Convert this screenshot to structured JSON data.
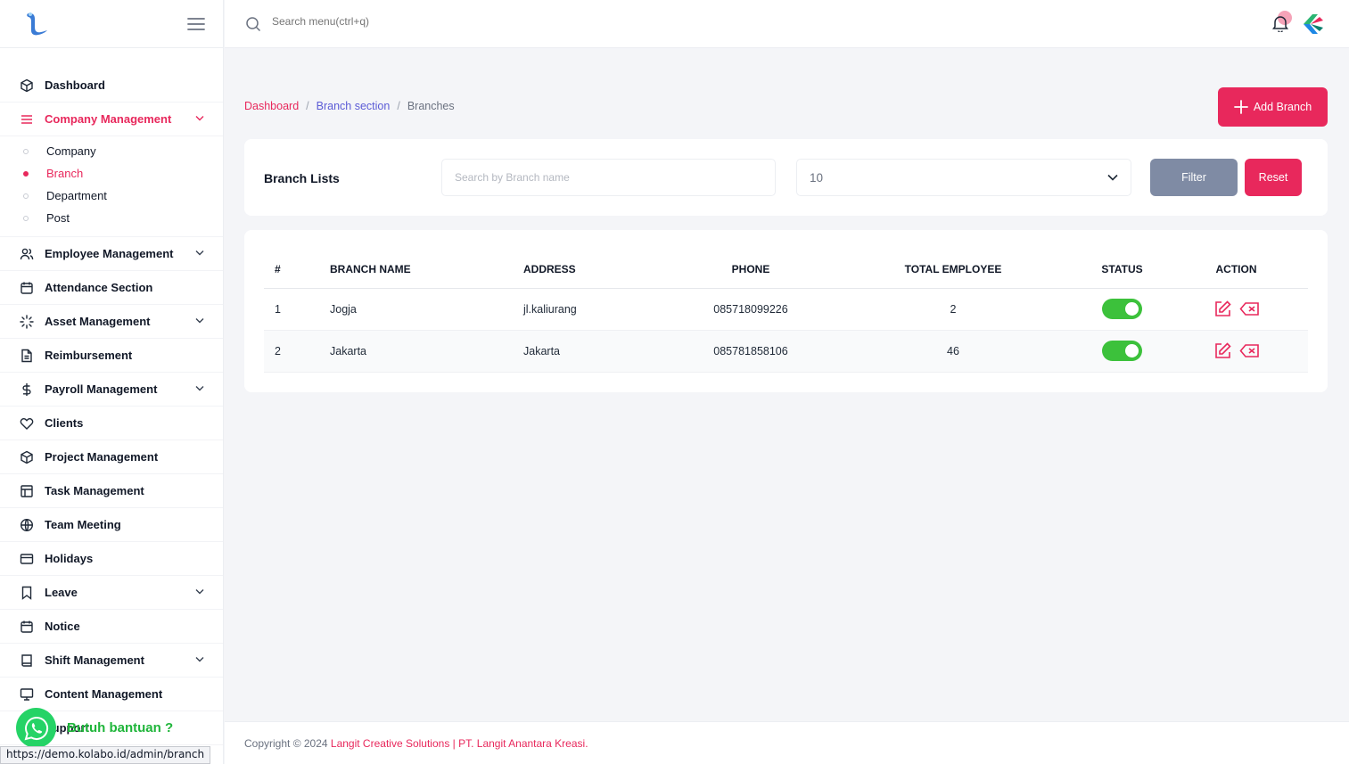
{
  "topbar": {
    "search_placeholder": "Search menu(ctrl+q)"
  },
  "sidebar": {
    "items": [
      {
        "label": "Dashboard",
        "icon": "cube-icon"
      },
      {
        "label": "Company Management",
        "icon": "list-icon",
        "active": true
      },
      {
        "label": "Employee Management",
        "icon": "users-icon"
      },
      {
        "label": "Attendance Section",
        "icon": "calendar-icon"
      },
      {
        "label": "Asset Management",
        "icon": "loader-icon"
      },
      {
        "label": "Reimbursement",
        "icon": "file-icon"
      },
      {
        "label": "Payroll Management",
        "icon": "dollar-icon"
      },
      {
        "label": "Clients",
        "icon": "heart-icon"
      },
      {
        "label": "Project Management",
        "icon": "cube-icon"
      },
      {
        "label": "Task Management",
        "icon": "table-icon"
      },
      {
        "label": "Team Meeting",
        "icon": "globe-icon"
      },
      {
        "label": "Holidays",
        "icon": "card-icon"
      },
      {
        "label": "Leave",
        "icon": "bookmark-icon"
      },
      {
        "label": "Notice",
        "icon": "calendar-icon"
      },
      {
        "label": "Shift Management",
        "icon": "book-icon"
      },
      {
        "label": "Content Management",
        "icon": "monitor-icon"
      },
      {
        "label": "Support",
        "icon": "help-icon"
      }
    ],
    "company_sub": [
      {
        "label": "Company"
      },
      {
        "label": "Branch",
        "active": true
      },
      {
        "label": "Department"
      },
      {
        "label": "Post"
      }
    ]
  },
  "breadcrumb": {
    "home": "Dashboard",
    "section": "Branch section",
    "current": "Branches",
    "sep": "/"
  },
  "add_button": "Add Branch",
  "filter": {
    "title": "Branch Lists",
    "search_placeholder": "Search by Branch name",
    "per_page": "10",
    "filter_label": "Filter",
    "reset_label": "Reset"
  },
  "table": {
    "headers": [
      "#",
      "BRANCH NAME",
      "ADDRESS",
      "PHONE",
      "TOTAL EMPLOYEE",
      "STATUS",
      "ACTION"
    ],
    "rows": [
      {
        "no": "1",
        "name": "Jogja",
        "address": "jl.kaliurang",
        "phone": "085718099226",
        "total": "2",
        "status": true
      },
      {
        "no": "2",
        "name": "Jakarta",
        "address": "Jakarta",
        "phone": "085781858106",
        "total": "46",
        "status": true
      }
    ]
  },
  "footer": {
    "prefix": "Copyright © 2024 ",
    "brand": "Langit Creative Solutions | PT. Langit Anantara Kreasi."
  },
  "whatsapp": {
    "label": "Butuh bantuan ?"
  },
  "status_url": "https://demo.kolabo.id/admin/branch",
  "colors": {
    "accent": "#e8285c",
    "secondary_link": "#5b5bd6",
    "filter_button": "#7f8ba4",
    "toggle_on": "#3cc13b",
    "whatsapp": "#25d366"
  }
}
